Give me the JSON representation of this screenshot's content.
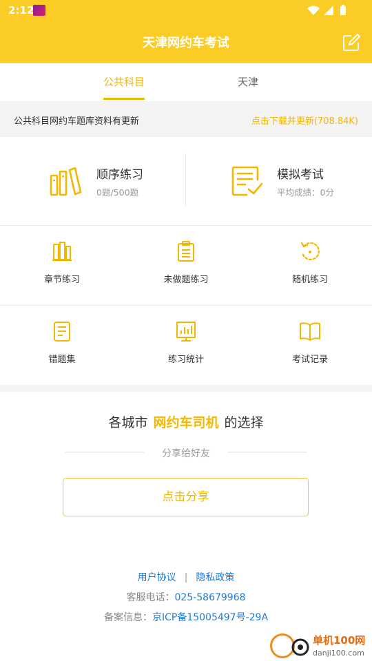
{
  "status_bar": {
    "time": "2:12"
  },
  "header": {
    "title": "天津网约车考试"
  },
  "tabs": [
    {
      "label": "公共科目",
      "active": true
    },
    {
      "label": "天津",
      "active": false
    }
  ],
  "notice": {
    "text": "公共科目网约车题库资料有更新",
    "action": "点击下载并更新(708.84K)"
  },
  "practice": {
    "sequential": {
      "title": "顺序练习",
      "progress": "0题/500题"
    },
    "mock_exam": {
      "title": "模拟考试",
      "score": "平均成绩：0分"
    }
  },
  "grid": [
    {
      "label": "章节练习",
      "icon": "books-icon"
    },
    {
      "label": "未做题练习",
      "icon": "clipboard-list-icon"
    },
    {
      "label": "随机练习",
      "icon": "refresh-icon"
    },
    {
      "label": "错题集",
      "icon": "notebook-icon"
    },
    {
      "label": "练习统计",
      "icon": "bar-chart-icon"
    },
    {
      "label": "考试记录",
      "icon": "open-book-icon"
    }
  ],
  "share": {
    "slogan_prefix": "各城市",
    "slogan_highlight": "网约车司机",
    "slogan_suffix": "的选择",
    "subtitle": "分享给好友",
    "button": "点击分享"
  },
  "footer": {
    "user_agreement": "用户协议",
    "separator": "|",
    "privacy_policy": "隐私政策",
    "phone_label": "客服电话：",
    "phone": "025-58679968",
    "record_label": "备案信息：",
    "record": "京ICP备15005497号-29A"
  },
  "watermark": {
    "name": "单机100网",
    "url": "danji100.com"
  },
  "colors": {
    "accent": "#fccc26",
    "accent_text": "#f2b700",
    "link": "#1f7ad6"
  }
}
